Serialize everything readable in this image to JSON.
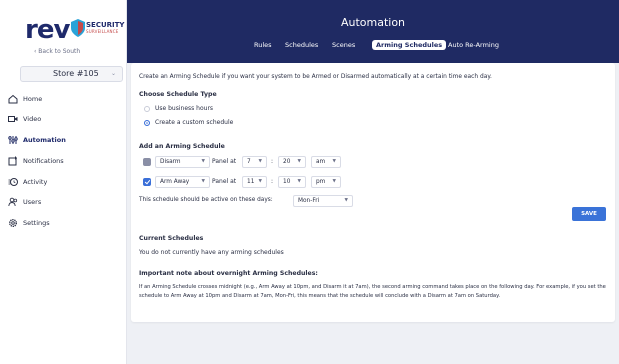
{
  "logo": {
    "text": "rev",
    "security": "SECURITY",
    "sub": "SURVEILLANCE"
  },
  "sidebar": {
    "back_label": "‹ Back to South",
    "store": "Store #105",
    "items": [
      {
        "label": "Home",
        "icon": "home-icon"
      },
      {
        "label": "Video",
        "icon": "video-icon"
      },
      {
        "label": "Automation",
        "icon": "automation-icon"
      },
      {
        "label": "Notifications",
        "icon": "notifications-icon"
      },
      {
        "label": "Activity",
        "icon": "activity-icon"
      },
      {
        "label": "Users",
        "icon": "users-icon"
      },
      {
        "label": "Settings",
        "icon": "settings-icon"
      }
    ],
    "active_index": 2
  },
  "header": {
    "title": "Automation",
    "tabs": [
      "Rules",
      "Schedules",
      "Scenes",
      "Arming Schedules",
      "Auto Re-Arming"
    ],
    "active_tab": "Arming Schedules"
  },
  "main": {
    "intro": "Create an Arming Schedule if you want your system to be Armed or Disarmed automatically at a certain time each day.",
    "choose_title": "Choose Schedule Type",
    "option_business": "Use business hours",
    "option_custom": "Create a custom schedule",
    "add_title": "Add an Arming Schedule",
    "rows": [
      {
        "mode": "Disarm",
        "panel_label": "Panel at",
        "hour": "7",
        "sep": ":",
        "minute": "20",
        "ampm": "am"
      },
      {
        "mode": "Arm Away",
        "panel_label": "Panel at",
        "hour": "11",
        "sep": ":",
        "minute": "10",
        "ampm": "pm"
      }
    ],
    "days_label": "This schedule should be active on these days:",
    "days_value": "Mon-Fri",
    "save_label": "SAVE",
    "current_title": "Current Schedules",
    "current_empty": "You do not currently have any arming schedules",
    "note_title": "Important note about overnight Arming Schedules:",
    "note_text": "If an Arming Schedule crosses midnight (e.g., Arm Away at 10pm, and Disarm it at 7am), the second arming command takes place on the following day. For example, if you set the schedule to Arm Away at 10pm and Disarm at 7am, Mon-Fri, this means that the schedule will conclude with a Disarm at 7am on Saturday."
  },
  "colors": {
    "navy": "#1f2a63",
    "accent": "#3a73d8",
    "background": "#eef0f5"
  }
}
